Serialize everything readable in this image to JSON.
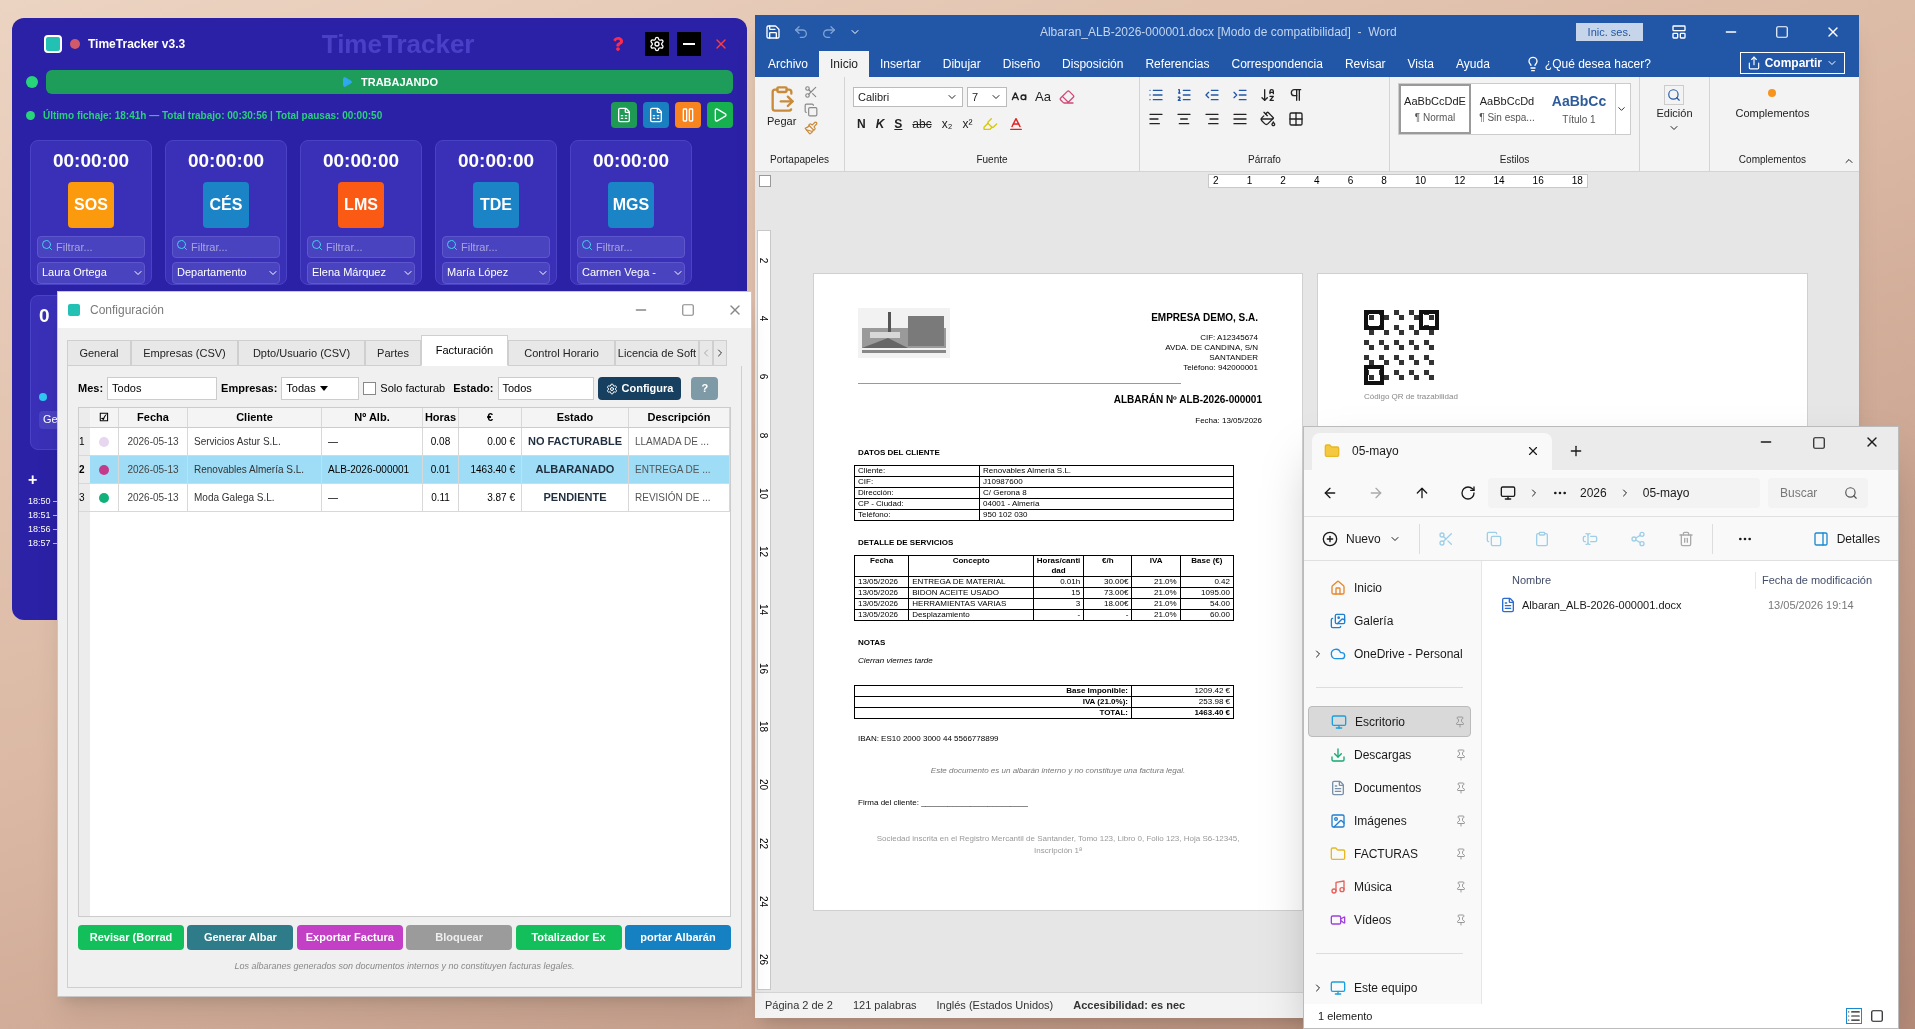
{
  "timetracker": {
    "title": "TimeTracker v3.3",
    "brand": "TimeTracker",
    "status": {
      "label": "TRABAJANDO",
      "on": true
    },
    "summary": "Último fichaje: 18:41h — Total trabajo: 00:30:56 | Total pausas: 00:00:50",
    "action_buttons": [
      {
        "kind": "spreadsheet",
        "color": "#1f9a55"
      },
      {
        "kind": "spreadsheet",
        "color": "#1a7fc0"
      },
      {
        "kind": "pause",
        "color": "#f7841f"
      },
      {
        "kind": "play",
        "color": "#17b04f"
      }
    ],
    "cards": [
      {
        "time": "00:00:00",
        "code": "SOS",
        "color": "#fb9a0c",
        "placeholder": "Filtrar...",
        "person": "Laura Ortega"
      },
      {
        "time": "00:00:00",
        "code": "CÉS",
        "color": "#1a84c7",
        "placeholder": "Filtrar...",
        "person": "Departamento"
      },
      {
        "time": "00:00:00",
        "code": "LMS",
        "color": "#fa5a14",
        "placeholder": "Filtrar...",
        "person": "Elena Márquez"
      },
      {
        "time": "00:00:00",
        "code": "TDE",
        "color": "#1a84c7",
        "placeholder": "Filtrar...",
        "person": "María López"
      },
      {
        "time": "00:00:00",
        "code": "MGS",
        "color": "#1a84c7",
        "placeholder": "Filtrar...",
        "person": "Carmen Vega -"
      }
    ],
    "second_card": {
      "time": "0",
      "button": "Ge"
    },
    "add_label": "+",
    "log_times": [
      "18:50 –",
      "18:51 –",
      "18:56 –",
      "18:57 –"
    ]
  },
  "config": {
    "title": "Configuración",
    "tabs": [
      {
        "label": "General",
        "selected": false
      },
      {
        "label": "Empresas (CSV)",
        "selected": false
      },
      {
        "label": "Dpto/Usuario (CSV)",
        "selected": false
      },
      {
        "label": "Partes",
        "selected": false
      },
      {
        "label": "Facturación",
        "selected": true
      },
      {
        "label": "Control Horario",
        "selected": false
      },
      {
        "label": "Licencia de Soft",
        "selected": false
      }
    ],
    "filters": {
      "month_label": "Mes:",
      "month": "Todos",
      "company_label": "Empresas:",
      "company": "Todas",
      "billable_label": "Solo facturab",
      "billable_checked": false,
      "state_label": "Estado:",
      "state": "Todos",
      "configure": "Configura",
      "help": "?"
    },
    "columns": [
      "☑",
      "Fecha",
      "Cliente",
      "Nº Alb.",
      "Horas",
      "€",
      "Estado",
      "Descripción"
    ],
    "rows": [
      {
        "number": "1",
        "color": "#e6d6ef",
        "date": "2026-05-13",
        "client": "Servicios Astur S.L.",
        "albaran": "—",
        "hours": "0.08",
        "amount": "0.00 €",
        "status": "NO FACTURABLE",
        "description": "LLAMADA DE ...",
        "selected": false
      },
      {
        "number": "2",
        "color": "#c43a8a",
        "date": "2026-05-13",
        "client": "Renovables Almería S.L.",
        "albaran": "ALB-2026-000001",
        "hours": "0.01",
        "amount": "1463.40 €",
        "status": "ALBARANADO",
        "description": "ENTREGA DE ...",
        "selected": true
      },
      {
        "number": "3",
        "color": "#12b07a",
        "date": "2026-05-13",
        "client": "Moda Galega S.L.",
        "albaran": "—",
        "hours": "0.11",
        "amount": "3.87 €",
        "status": "PENDIENTE",
        "description": "REVISIÓN DE ...",
        "selected": false
      }
    ],
    "buttons": [
      {
        "label": "Revisar (Borrad",
        "color": "#12bf5b",
        "disabled": false
      },
      {
        "label": "Generar Albar",
        "color": "#2e7c8a",
        "disabled": false
      },
      {
        "label": "Exportar Factura",
        "color": "#c23fc6",
        "disabled": false
      },
      {
        "label": "Bloquear",
        "color": "#9b9b9b",
        "disabled": true
      },
      {
        "label": "Totalizador Ex",
        "color": "#12bf5b",
        "disabled": false
      },
      {
        "label": "portar Albarán",
        "color": "#1581c3",
        "disabled": false
      }
    ],
    "note": "Los albaranes generados son documentos internos y no constituyen facturas legales."
  },
  "word": {
    "title": "Albaran_ALB-2026-000001.docx [Modo de compatibilidad]  -  Word",
    "sign_in": "Inic. ses.",
    "tabs": [
      {
        "label": "Archivo",
        "selected": false
      },
      {
        "label": "Inicio",
        "selected": true
      },
      {
        "label": "Insertar",
        "selected": false
      },
      {
        "label": "Dibujar",
        "selected": false
      },
      {
        "label": "Diseño",
        "selected": false
      },
      {
        "label": "Disposición",
        "selected": false
      },
      {
        "label": "Referencias",
        "selected": false
      },
      {
        "label": "Correspondencia",
        "selected": false
      },
      {
        "label": "Revisar",
        "selected": false
      },
      {
        "label": "Vista",
        "selected": false
      },
      {
        "label": "Ayuda",
        "selected": false
      }
    ],
    "tell_me": "¿Qué desea hacer?",
    "share": "Compartir",
    "paste": "Pegar",
    "font": "Calibri",
    "font_size": "7",
    "case_button": "Aa",
    "format_buttons": [
      "N",
      "K",
      "S",
      "abc",
      "x₂",
      "x²"
    ],
    "styles": [
      {
        "preview": "AaBbCcDdE",
        "name": "¶ Normal",
        "selected": true,
        "kind": "body"
      },
      {
        "preview": "AaBbCcDd",
        "name": "¶ Sin espa...",
        "selected": false,
        "kind": "body"
      },
      {
        "preview": "AaBbCc",
        "name": "Título 1",
        "selected": false,
        "kind": "heading"
      }
    ],
    "editing": "Edición",
    "addins": "Complementos",
    "groups": [
      "Portapapeles",
      "Fuente",
      "Párrafo",
      "Estilos",
      "Complementos"
    ],
    "ruler": [
      "2",
      "1",
      "2",
      "4",
      "6",
      "8",
      "10",
      "12",
      "14",
      "16",
      "18"
    ],
    "vruler": [
      "2",
      "4",
      "6",
      "8",
      "10",
      "12",
      "14",
      "16",
      "18",
      "20",
      "22",
      "24",
      "26"
    ],
    "status": [
      "Página 2 de 2",
      "121 palabras",
      "Inglés (Estados Unidos)",
      "Accesibilidad: es nec"
    ]
  },
  "document": {
    "company": "EMPRESA DEMO, S.A.",
    "company_lines": [
      "CIF: A12345674",
      "AVDA. DE CANDINA, S/N",
      "SANTANDER",
      "Teléfono: 942000001"
    ],
    "title": "ALBARÁN Nº ALB-2026-000001",
    "date": "Fecha: 13/05/2026",
    "client_heading": "DATOS DEL CLIENTE",
    "client_rows": [
      [
        "Cliente:",
        "Renovables Almería S.L."
      ],
      [
        "CIF:",
        "J10987600"
      ],
      [
        "Dirección:",
        "C/ Gerona 8"
      ],
      [
        "CP - Ciudad:",
        "04001 - Almería"
      ],
      [
        "Teléfono:",
        "950 102 030"
      ]
    ],
    "services_heading": "DETALLE DE SERVICIOS",
    "services_columns": [
      "Fecha",
      "Concepto",
      "Horas/cantidad",
      "€/h",
      "IVA",
      "Base (€)"
    ],
    "services_rows": [
      [
        "13/05/2026",
        "ENTREGA DE MATERIAL",
        "0.01h",
        "30.00€",
        "21.0%",
        "0.42"
      ],
      [
        "13/05/2026",
        "BIDON ACEITE USADO",
        "15",
        "73.00€",
        "21.0%",
        "1095.00"
      ],
      [
        "13/05/2026",
        "HERRAMIENTAS VARIAS",
        "3",
        "18.00€",
        "21.0%",
        "54.00"
      ],
      [
        "13/05/2026",
        "Desplazamiento",
        "-",
        "-",
        "21.0%",
        "60.00"
      ]
    ],
    "notes_heading": "NOTAS",
    "notes": "Cierran viernes tarde",
    "totals": [
      {
        "label": "Base Imponible:",
        "value": "1209.42 €",
        "kind": "subtotal"
      },
      {
        "label": "IVA (21.0%):",
        "value": "253.98 €",
        "kind": "subtotal"
      },
      {
        "label": "TOTAL:",
        "value": "1463.40 €",
        "kind": "total"
      }
    ],
    "iban": "IBAN: ES10 2000 3000 44 5566778899",
    "disclaimer": "Este documento es un albarán interno y no constituye una factura legal.",
    "signature": "Firma del cliente: ________________________",
    "footer": "Sociedad inscrita en el Registro Mercantil de Santander, Tomo 123, Libro 0, Folio 123, Hoja S6-12345, Inscripción 1ª",
    "qr_caption": "Código QR de trazabilidad"
  },
  "explorer": {
    "tab": "05-mayo",
    "path": [
      "2026",
      "05-mayo"
    ],
    "search_placeholder": "Buscar",
    "new": "Nuevo",
    "details": "Detalles",
    "nav": [
      {
        "label": "Inicio",
        "kind": "home",
        "selected": false,
        "pinned": false,
        "expandable": false
      },
      {
        "label": "Galería",
        "kind": "gallery",
        "selected": false,
        "pinned": false,
        "expandable": false
      },
      {
        "label": "OneDrive - Personal",
        "kind": "cloud",
        "selected": false,
        "pinned": false,
        "expandable": true
      },
      {
        "kind": "divider"
      },
      {
        "label": "Escritorio",
        "kind": "desktop",
        "selected": true,
        "pinned": true,
        "expandable": false
      },
      {
        "label": "Descargas",
        "kind": "download",
        "selected": false,
        "pinned": true,
        "expandable": false
      },
      {
        "label": "Documentos",
        "kind": "documents",
        "selected": false,
        "pinned": true,
        "expandable": false
      },
      {
        "label": "Imágenes",
        "kind": "images",
        "selected": false,
        "pinned": true,
        "expandable": false
      },
      {
        "label": "FACTURAS",
        "kind": "folder",
        "selected": false,
        "pinned": true,
        "expandable": false
      },
      {
        "label": "Música",
        "kind": "music",
        "selected": false,
        "pinned": true,
        "expandable": false
      },
      {
        "label": "Vídeos",
        "kind": "video",
        "selected": false,
        "pinned": true,
        "expandable": false
      },
      {
        "kind": "divider"
      },
      {
        "label": "Este equipo",
        "kind": "computer",
        "selected": false,
        "pinned": false,
        "expandable": true
      }
    ],
    "columns": [
      "Nombre",
      "Fecha de modificación"
    ],
    "files": [
      {
        "name": "Albaran_ALB-2026-000001.docx",
        "modified": "13/05/2026 19:14"
      }
    ],
    "status": "1 elemento"
  }
}
